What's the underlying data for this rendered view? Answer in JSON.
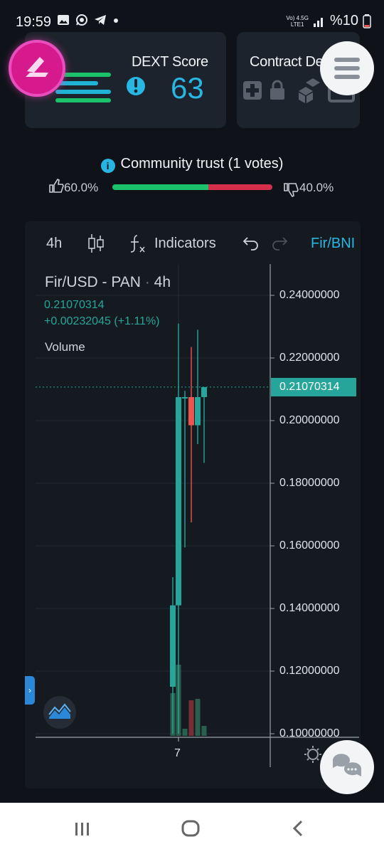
{
  "status_bar": {
    "time": "19:59",
    "network_top": "Vo) 4.5G",
    "network_bottom": "LTE1",
    "battery": "%10"
  },
  "score_card": {
    "title": "DEXT Score",
    "score": "63"
  },
  "contract_card": {
    "title": "Contract De"
  },
  "community": {
    "title": "Community trust (1 votes)",
    "positive_percent": "60.0%",
    "negative_percent": "40.0%",
    "positive_fraction": 0.6
  },
  "toolbar": {
    "interval": "4h",
    "indicators_label": "Indicators",
    "pair_label": "Fir/BNI"
  },
  "chart_legend": {
    "title": "Fir/USD - PAN",
    "interval": "4h",
    "price": "0.21070314",
    "change": "+0.00232045 (+1.11%)",
    "volume_label": "Volume"
  },
  "chart_data": {
    "type": "candlestick",
    "title": "Fir/USD - PAN · 4h",
    "y_ticks": [
      "0.24000000",
      "0.22000000",
      "0.20000000",
      "0.18000000",
      "0.16000000",
      "0.14000000",
      "0.12000000",
      "0.10000000"
    ],
    "ylim": [
      0.1,
      0.24
    ],
    "x_ticks": [
      "7"
    ],
    "last_price": "0.21070314",
    "candles": [
      {
        "open": 0.115,
        "high": 0.15,
        "low": 0.1,
        "close": 0.141,
        "color": "up"
      },
      {
        "open": 0.141,
        "high": 0.231,
        "low": 0.1,
        "close": 0.2075,
        "color": "up"
      },
      {
        "open": 0.2075,
        "high": 0.2095,
        "low": 0.1595,
        "close": 0.2075,
        "color": "up"
      },
      {
        "open": 0.2075,
        "high": 0.2235,
        "low": 0.1675,
        "close": 0.1985,
        "color": "down"
      },
      {
        "open": 0.1985,
        "high": 0.229,
        "low": 0.1925,
        "close": 0.2075,
        "color": "up"
      },
      {
        "open": 0.2075,
        "high": 0.2105,
        "low": 0.1865,
        "close": 0.2107,
        "color": "up"
      }
    ],
    "volumes": [
      {
        "value": 0.6,
        "color": "up"
      },
      {
        "value": 1.0,
        "color": "up"
      },
      {
        "value": 0.1,
        "color": "up"
      },
      {
        "value": 0.5,
        "color": "down"
      },
      {
        "value": 0.52,
        "color": "up"
      },
      {
        "value": 0.14,
        "color": "up"
      }
    ]
  },
  "colors": {
    "up": "#26a69a",
    "down": "#ef5350",
    "accent": "#28b6e2",
    "logo": "#d6198c"
  }
}
